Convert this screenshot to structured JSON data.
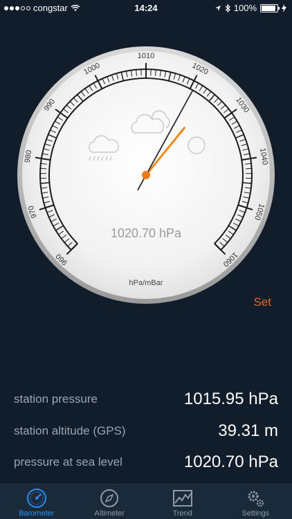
{
  "status_bar": {
    "carrier": "congstar",
    "time": "14:24",
    "battery": "100%",
    "battery_level": 1.0
  },
  "gauge": {
    "unit_label": "hPa/mBar",
    "reading_text": "1020.70 hPa",
    "scale_min": 960,
    "scale_max": 1060,
    "tick_labels": [
      "960",
      "970",
      "980",
      "990",
      "1000",
      "1010",
      "1020",
      "1030",
      "1040",
      "1050",
      "1060"
    ],
    "needle_value": 1020.7,
    "reference_value": 1024.5,
    "colors": {
      "needle": "#2b2b2b",
      "reference_needle": "#f08a1a",
      "center": "#f07a1a"
    },
    "weather_icons": [
      "cloud-rain-icon",
      "cloud-icon",
      "sun-icon"
    ]
  },
  "set_label": "Set",
  "readings": [
    {
      "label": "station pressure",
      "value": "1015.95 hPa"
    },
    {
      "label": "station altitude (GPS)",
      "value": "39.31 m"
    },
    {
      "label": "pressure at sea level",
      "value": "1020.70 hPa"
    }
  ],
  "tabs": [
    {
      "label": "Barometer",
      "icon": "gauge-icon",
      "active": true
    },
    {
      "label": "Altimeter",
      "icon": "compass-icon",
      "active": false
    },
    {
      "label": "Trend",
      "icon": "trend-chart-icon",
      "active": false
    },
    {
      "label": "Settings",
      "icon": "gears-icon",
      "active": false
    }
  ],
  "colors": {
    "background": "#111d2b",
    "accent": "#2b8ef0",
    "set": "#e06a2a"
  }
}
